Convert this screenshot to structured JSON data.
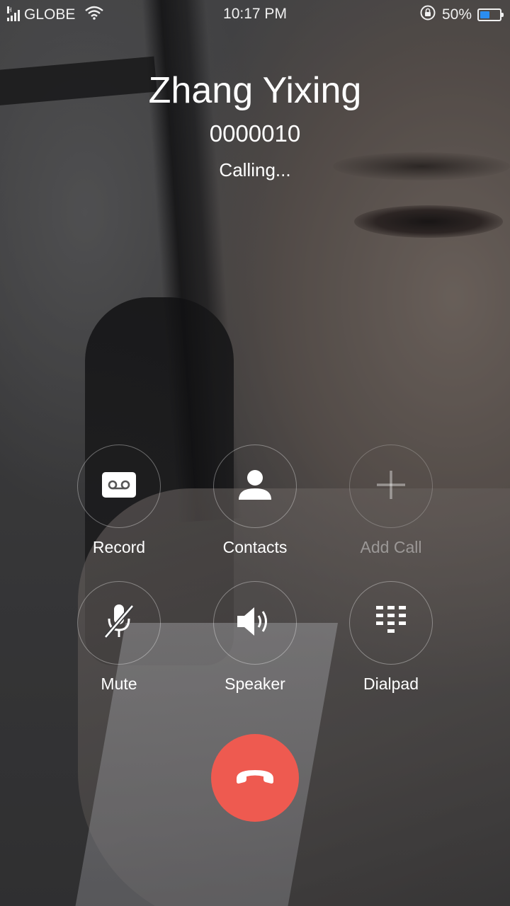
{
  "status_bar": {
    "carrier": "GLOBE",
    "signal_icon": "signal-bars-icon",
    "network_type": "H",
    "wifi_icon": "wifi-icon",
    "time": "10:17 PM",
    "rotation_lock_icon": "rotation-lock-icon",
    "battery_percent": "50%",
    "battery_level": 0.5,
    "battery_color": "#2a8df0"
  },
  "caller": {
    "name": "Zhang Yixing",
    "number": "0000010",
    "status": "Calling..."
  },
  "actions": [
    {
      "id": "record",
      "label": "Record",
      "icon": "voicemail-tape-icon",
      "enabled": true
    },
    {
      "id": "contacts",
      "label": "Contacts",
      "icon": "person-icon",
      "enabled": true
    },
    {
      "id": "add-call",
      "label": "Add Call",
      "icon": "plus-icon",
      "enabled": false
    },
    {
      "id": "mute",
      "label": "Mute",
      "icon": "microphone-off-icon",
      "enabled": true
    },
    {
      "id": "speaker",
      "label": "Speaker",
      "icon": "speaker-icon",
      "enabled": true
    },
    {
      "id": "dialpad",
      "label": "Dialpad",
      "icon": "dialpad-icon",
      "enabled": true
    }
  ],
  "end_call": {
    "icon": "phone-hangup-icon",
    "color": "#ee5a50"
  }
}
